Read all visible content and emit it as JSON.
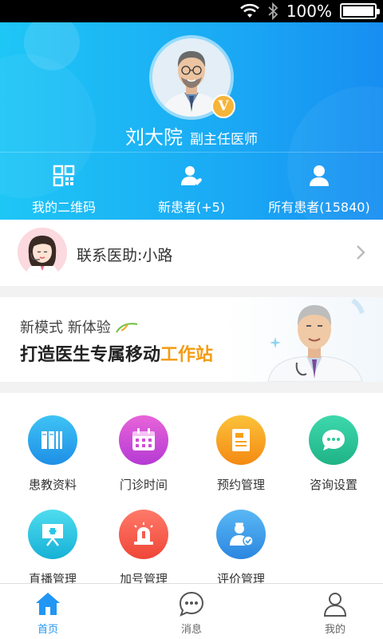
{
  "status_bar": {
    "battery": "100%",
    "battery_level": 1.0
  },
  "doctor": {
    "name": "刘大院",
    "title": "副主任医师",
    "badge": "V"
  },
  "quick_actions": [
    {
      "label": "我的二维码",
      "icon": "qr-code-icon"
    },
    {
      "label": "新患者(+5)",
      "icon": "new-patient-icon"
    },
    {
      "label": "所有患者(15840)",
      "icon": "all-patients-icon"
    }
  ],
  "assistant": {
    "label": "联系医助:小路"
  },
  "banner": {
    "subtitle": "新模式 新体验",
    "title_main": "打造医生专属移动",
    "title_highlight": "工作站"
  },
  "grid": [
    {
      "label": "患教资料",
      "icon": "books-icon",
      "color": "#2aa3ec"
    },
    {
      "label": "门诊时间",
      "icon": "calendar-icon",
      "color": "#d44bd8"
    },
    {
      "label": "预约管理",
      "icon": "document-icon",
      "color": "#f7a21b"
    },
    {
      "label": "咨询设置",
      "icon": "chat-bubble-icon",
      "color": "#2ec89a"
    },
    {
      "label": "直播管理",
      "icon": "presentation-icon",
      "color": "#26c7e3"
    },
    {
      "label": "加号管理",
      "icon": "siren-icon",
      "color": "#f55d4f"
    },
    {
      "label": "评价管理",
      "icon": "doctor-rating-icon",
      "color": "#3e9fe8"
    }
  ],
  "tabbar": [
    {
      "label": "首页",
      "icon": "home-icon",
      "active": true
    },
    {
      "label": "消息",
      "icon": "message-icon",
      "active": false
    },
    {
      "label": "我的",
      "icon": "profile-icon",
      "active": false
    }
  ]
}
